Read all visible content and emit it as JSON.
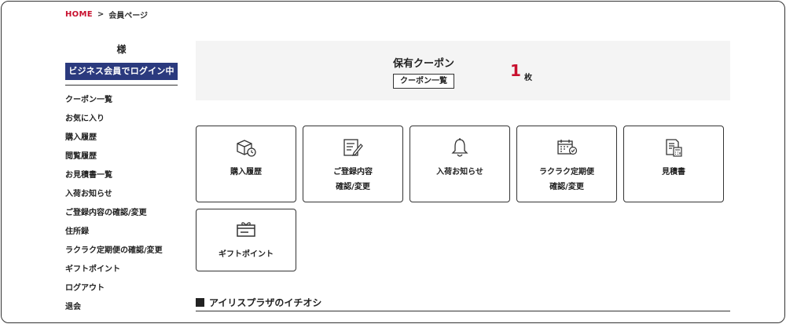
{
  "breadcrumb": {
    "home": "HOME",
    "separator": ">",
    "current": "会員ページ"
  },
  "sidebar": {
    "user_name": "様",
    "member_badge": "ビジネス会員でログイン中",
    "items": [
      {
        "label": "クーポン一覧"
      },
      {
        "label": "お気に入り"
      },
      {
        "label": "購入履歴"
      },
      {
        "label": "閲覧履歴"
      },
      {
        "label": "お見積書一覧"
      },
      {
        "label": "入荷お知らせ"
      },
      {
        "label": "ご登録内容の確認/変更"
      },
      {
        "label": "住所録"
      },
      {
        "label": "ラクラク定期便の確認/変更"
      },
      {
        "label": "ギフトポイント"
      },
      {
        "label": "ログアウト"
      },
      {
        "label": "退会"
      }
    ]
  },
  "coupon": {
    "title": "保有クーポン",
    "list_button": "クーポン一覧",
    "count": "1",
    "unit": "枚"
  },
  "tiles": [
    {
      "label": "購入履歴",
      "icon": "box-clock-icon"
    },
    {
      "label": "ご登録内容\n確認/変更",
      "icon": "document-edit-icon"
    },
    {
      "label": "入荷お知らせ",
      "icon": "bell-icon"
    },
    {
      "label": "ラクラク定期便\n確認/変更",
      "icon": "calendar-check-icon"
    },
    {
      "label": "見積書",
      "icon": "calculator-document-icon"
    },
    {
      "label": "ギフトポイント",
      "icon": "gift-card-icon"
    }
  ],
  "section": {
    "heading": "アイリスプラザのイチオシ"
  },
  "colors": {
    "accent_red": "#c8102e",
    "badge_navy": "#2b3a7e"
  }
}
